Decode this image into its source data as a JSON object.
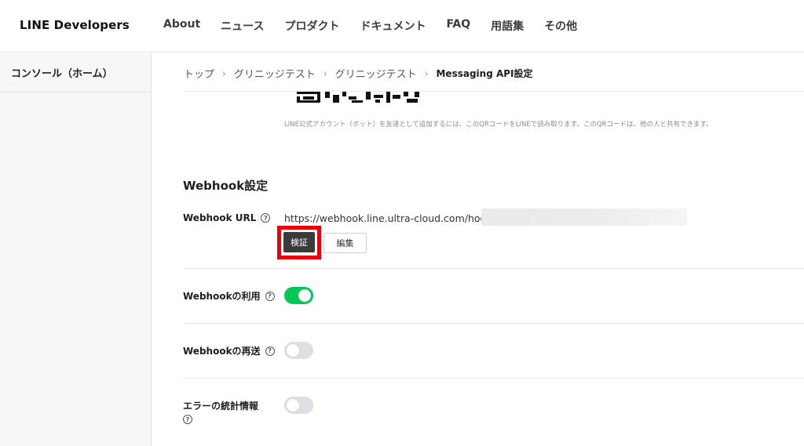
{
  "header": {
    "logo": "LINE Developers",
    "nav": [
      "About",
      "ニュース",
      "プロダクト",
      "ドキュメント",
      "FAQ",
      "用語集",
      "その他"
    ]
  },
  "sidebar": {
    "items": [
      {
        "label": "コンソール（ホーム）"
      }
    ]
  },
  "breadcrumb": {
    "items": [
      "トップ",
      "グリニッジテスト",
      "グリニッジテスト"
    ],
    "current": "Messaging API設定",
    "separator": "›"
  },
  "qr": {
    "note": "LINE公式アカウント（ボット）を友達として追加するには、このQRコードをLINEで読み取ります。このQRコードは、他の人と共有できます。"
  },
  "webhook": {
    "section_title": "Webhook設定",
    "url_label": "Webhook URL",
    "url_value": "https://webhook.line.ultra-cloud.com/hook/",
    "verify_label": "検証",
    "edit_label": "編集",
    "use_label": "Webhookの利用",
    "use_enabled": true,
    "resend_label": "Webhookの再送",
    "resend_enabled": false,
    "error_stats_label": "エラーの統計情報",
    "error_stats_enabled": false
  },
  "colors": {
    "toggle_on": "#06c755",
    "toggle_off": "#dcdfe3",
    "highlight": "#e8000a",
    "verify_button": "#3a3a3a"
  },
  "icons": {
    "help": "help-circle-icon"
  }
}
